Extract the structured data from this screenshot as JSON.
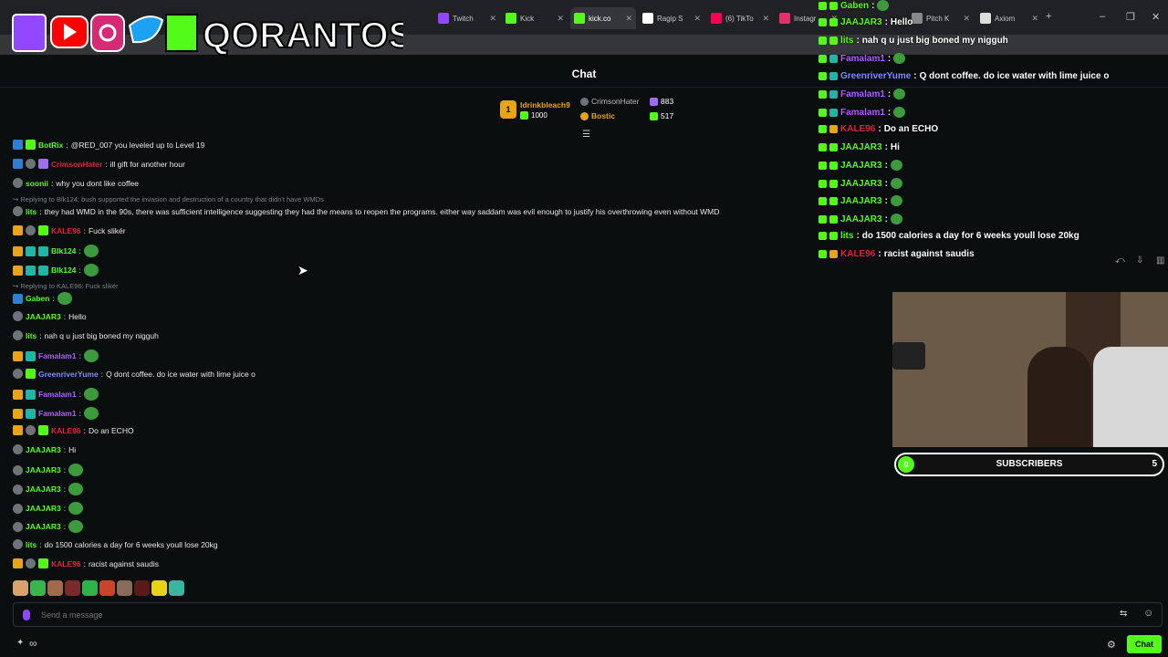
{
  "browser": {
    "tabs": [
      {
        "label": "Twitch",
        "color": "#9146ff"
      },
      {
        "label": "Kick",
        "color": "#53fc18"
      },
      {
        "label": "kick.co",
        "color": "#53fc18"
      },
      {
        "label": "Ragip S",
        "color": "#ffffff"
      },
      {
        "label": "(6) TikTo",
        "color": "#ff0050"
      },
      {
        "label": "Instagr",
        "color": "#e1306c"
      },
      {
        "label": "Pitch K",
        "color": "#888888"
      },
      {
        "label": "Axiom",
        "color": "#dddddd"
      }
    ],
    "new_tab": "+",
    "minimize": "–",
    "restore": "❐",
    "close": "✕"
  },
  "logo": {
    "text": "QORANTOS"
  },
  "chat": {
    "title": "Chat",
    "leaderboard": {
      "first": {
        "rank": "1",
        "name": "Idrinkbleach9",
        "value": "1000"
      },
      "second": {
        "name": "CrimsonHater",
        "value": "883"
      },
      "third": {
        "name": "Bostic",
        "value": "517"
      }
    },
    "reply_1": "↪ Replying to Blk124: bush supported the invasion and destruction of a country that didn't have WMDs",
    "reply_2": "↪ Replying to KALE96: Fuck slikér",
    "messages": [
      {
        "user": "BotRix",
        "color": "#53fc18",
        "text": "@RED_007 you leveled up to Level 19"
      },
      {
        "user": "CrimsonHater",
        "color": "#e0243a",
        "text": "ill gift for another hour"
      },
      {
        "user": "soonii",
        "color": "#53fc18",
        "text": "why you dont like coffee"
      },
      {
        "user": "lits",
        "color": "#53fc18",
        "text": "they had WMD in the 90s, there was sufficient intelligence suggesting they had the means to reopen the programs. either way saddam was evil enough to justify his overthrowing even without WMD"
      },
      {
        "user": "KALE96",
        "color": "#e0243a",
        "text": "Fuck slikér"
      },
      {
        "user": "Blk124",
        "color": "#53fc18",
        "text": ""
      },
      {
        "user": "Blk124",
        "color": "#53fc18",
        "text": ""
      },
      {
        "user": "Gaben",
        "color": "#53fc18",
        "text": ""
      },
      {
        "user": "JAAJAR3",
        "color": "#53fc18",
        "text": "Hello"
      },
      {
        "user": "lits",
        "color": "#53fc18",
        "text": "nah q u just big boned my nigguh"
      },
      {
        "user": "Famalam1",
        "color": "#b05cff",
        "text": ""
      },
      {
        "user": "GreenriverYume",
        "color": "#7e8cff",
        "text": "Q dont coffee. do ice water with lime juice o"
      },
      {
        "user": "Famalam1",
        "color": "#b05cff",
        "text": ""
      },
      {
        "user": "Famalam1",
        "color": "#b05cff",
        "text": ""
      },
      {
        "user": "KALE96",
        "color": "#e0243a",
        "text": "Do an ECHO"
      },
      {
        "user": "JAAJAR3",
        "color": "#53fc18",
        "text": "Hi"
      },
      {
        "user": "JAAJAR3",
        "color": "#53fc18",
        "text": ""
      },
      {
        "user": "JAAJAR3",
        "color": "#53fc18",
        "text": ""
      },
      {
        "user": "JAAJAR3",
        "color": "#53fc18",
        "text": ""
      },
      {
        "user": "JAAJAR3",
        "color": "#53fc18",
        "text": ""
      },
      {
        "user": "lits",
        "color": "#53fc18",
        "text": "do 1500 calories a day for 6 weeks youll lose 20kg"
      },
      {
        "user": "KALE96",
        "color": "#e0243a",
        "text": "racist against saudis"
      }
    ],
    "input_placeholder": "Send a message",
    "send_label": "Chat",
    "infinity": "∞"
  },
  "overlay": {
    "messages": [
      {
        "user": "Gaben",
        "color": "#53fc18",
        "text": ""
      },
      {
        "user": "JAAJAR3",
        "color": "#53fc18",
        "text": "Hello"
      },
      {
        "user": "lits",
        "color": "#53fc18",
        "text": "nah q u just big boned my nigguh"
      },
      {
        "user": "Famalam1",
        "color": "#b05cff",
        "text": ""
      },
      {
        "user": "GreenriverYume",
        "color": "#7e8cff",
        "text": "Q dont coffee. do ice water with lime juice o"
      },
      {
        "user": "Famalam1",
        "color": "#b05cff",
        "text": ""
      },
      {
        "user": "Famalam1",
        "color": "#b05cff",
        "text": ""
      },
      {
        "user": "KALE96",
        "color": "#e0243a",
        "text": "Do an ECHO"
      },
      {
        "user": "JAAJAR3",
        "color": "#53fc18",
        "text": "Hi"
      },
      {
        "user": "JAAJAR3",
        "color": "#53fc18",
        "text": ""
      },
      {
        "user": "JAAJAR3",
        "color": "#53fc18",
        "text": ""
      },
      {
        "user": "JAAJAR3",
        "color": "#53fc18",
        "text": ""
      },
      {
        "user": "JAAJAR3",
        "color": "#53fc18",
        "text": ""
      },
      {
        "user": "lits",
        "color": "#53fc18",
        "text": "do 1500 calories a day for 6 weeks youll lose 20kg"
      },
      {
        "user": "KALE96",
        "color": "#e0243a",
        "text": "racist against saudis"
      }
    ],
    "subscribers": {
      "current": "0",
      "label": "SUBSCRIBERS",
      "goal": "5"
    }
  }
}
